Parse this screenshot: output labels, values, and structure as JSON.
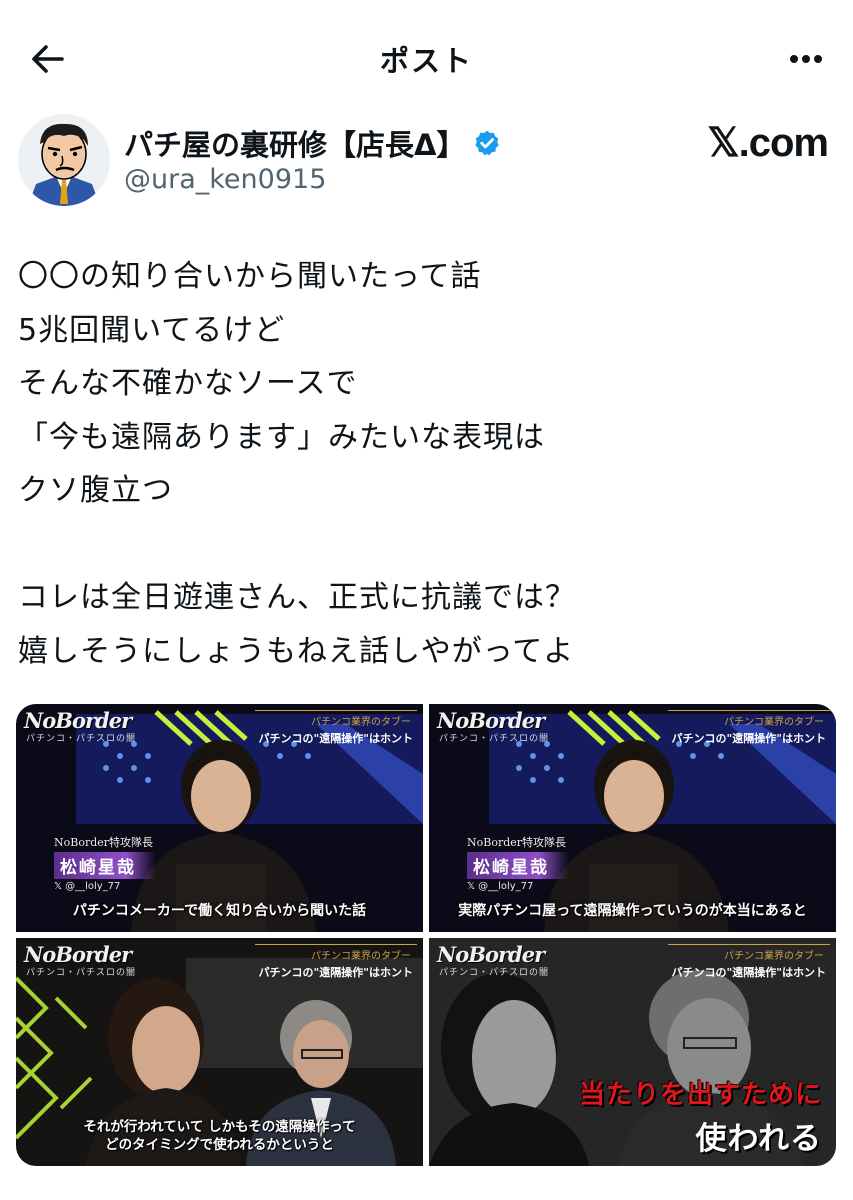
{
  "header": {
    "title": "ポスト"
  },
  "author": {
    "display_name": "パチ屋の裏研修【店長Δ】",
    "handle": "@ura_ken0915",
    "verified": true
  },
  "watermark": "𝕏.com",
  "tweet": {
    "lines": [
      "〇〇の知り合いから聞いたって話",
      "5兆回聞いてるけど",
      "そんな不確かなソースで",
      "「今も遠隔あります」みたいな表現は",
      "クソ腹立つ",
      "",
      "コレは全日遊連さん、正式に抗議では？",
      "嬉しそうにしょうもねえ話しやがってよ"
    ]
  },
  "media": [
    {
      "logo": "NoBorder",
      "logo_sub": "パチンコ・パチスロの闇",
      "tag_top": "パチンコ業界のタブー",
      "tag_main": "パチンコの\"遠隔操作\"はホント",
      "role": "NoBorder特攻隊長",
      "name": "松崎星哉",
      "name_handle": "@__loly_77",
      "caption": "パチンコメーカーで働く知り合いから聞いた話"
    },
    {
      "logo": "NoBorder",
      "logo_sub": "パチンコ・パチスロの闇",
      "tag_top": "パチンコ業界のタブー",
      "tag_main": "パチンコの\"遠隔操作\"はホント",
      "role": "NoBorder特攻隊長",
      "name": "松崎星哉",
      "name_handle": "@__loly_77",
      "caption": "実際パチンコ屋って遠隔操作っていうのが本当にあると"
    },
    {
      "logo": "NoBorder",
      "logo_sub": "パチンコ・パチスロの闇",
      "tag_top": "パチンコ業界のタブー",
      "tag_main": "パチンコの\"遠隔操作\"はホント",
      "caption_line1": "それが行われていて しかもその遠隔操作って",
      "caption_line2": "どのタイミングで使われるかというと"
    },
    {
      "logo": "NoBorder",
      "logo_sub": "パチンコ・パチスロの闇",
      "tag_top": "パチンコ業界のタブー",
      "tag_main": "パチンコの\"遠隔操作\"はホント",
      "big_red": "当たりを出すために",
      "big_white": "使われる"
    }
  ]
}
